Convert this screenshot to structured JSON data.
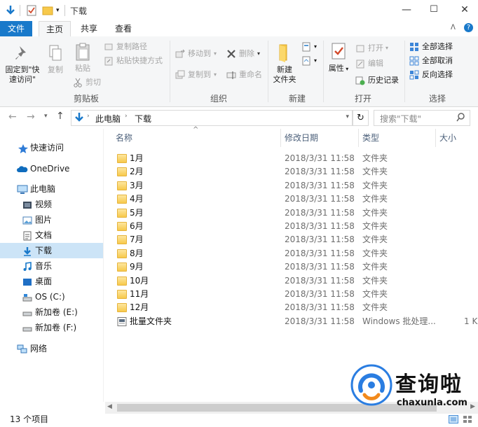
{
  "window": {
    "title": "下载",
    "minimize_glyph": "—",
    "maximize_glyph": "☐",
    "close_glyph": "✕"
  },
  "ribbon_tabs": [
    "文件",
    "主页",
    "共享",
    "查看"
  ],
  "ribbon": {
    "clipboard": {
      "pin_label_line1": "固定到\"快",
      "pin_label_line2": "速访问\"",
      "copy": "复制",
      "paste": "粘贴",
      "copy_path": "复制路径",
      "paste_shortcut": "粘贴快捷方式",
      "cut": "剪切",
      "group": "剪贴板"
    },
    "organize": {
      "move_to": "移动到",
      "copy_to": "复制到",
      "delete": "删除",
      "rename": "重命名",
      "group": "组织"
    },
    "new": {
      "new_folder_line1": "新建",
      "new_folder_line2": "文件夹",
      "group": "新建"
    },
    "open": {
      "properties": "属性",
      "open": "打开",
      "edit": "编辑",
      "history": "历史记录",
      "group": "打开"
    },
    "select": {
      "select_all": "全部选择",
      "select_none": "全部取消",
      "invert": "反向选择",
      "group": "选择"
    }
  },
  "address": {
    "crumb1": "此电脑",
    "crumb2": "下载",
    "search_placeholder": "搜索\"下载\""
  },
  "nav": {
    "quick_access": "快速访问",
    "onedrive": "OneDrive",
    "this_pc": "此电脑",
    "videos": "视频",
    "pictures": "图片",
    "documents": "文档",
    "downloads": "下载",
    "music": "音乐",
    "desktop": "桌面",
    "drive_c": "OS (C:)",
    "drive_e": "新加卷 (E:)",
    "drive_f": "新加卷 (F:)",
    "network": "网络"
  },
  "columns": {
    "name": "名称",
    "modified": "修改日期",
    "type": "类型",
    "size": "大小"
  },
  "files": [
    {
      "name": "1月",
      "modified": "2018/3/31 11:58",
      "type": "文件夹",
      "size": ""
    },
    {
      "name": "2月",
      "modified": "2018/3/31 11:58",
      "type": "文件夹",
      "size": ""
    },
    {
      "name": "3月",
      "modified": "2018/3/31 11:58",
      "type": "文件夹",
      "size": ""
    },
    {
      "name": "4月",
      "modified": "2018/3/31 11:58",
      "type": "文件夹",
      "size": ""
    },
    {
      "name": "5月",
      "modified": "2018/3/31 11:58",
      "type": "文件夹",
      "size": ""
    },
    {
      "name": "6月",
      "modified": "2018/3/31 11:58",
      "type": "文件夹",
      "size": ""
    },
    {
      "name": "7月",
      "modified": "2018/3/31 11:58",
      "type": "文件夹",
      "size": ""
    },
    {
      "name": "8月",
      "modified": "2018/3/31 11:58",
      "type": "文件夹",
      "size": ""
    },
    {
      "name": "9月",
      "modified": "2018/3/31 11:58",
      "type": "文件夹",
      "size": ""
    },
    {
      "name": "10月",
      "modified": "2018/3/31 11:58",
      "type": "文件夹",
      "size": ""
    },
    {
      "name": "11月",
      "modified": "2018/3/31 11:58",
      "type": "文件夹",
      "size": ""
    },
    {
      "name": "12月",
      "modified": "2018/3/31 11:58",
      "type": "文件夹",
      "size": ""
    },
    {
      "name": "批量文件夹",
      "modified": "2018/3/31 11:58",
      "type": "Windows 批处理...",
      "size": "1 K"
    }
  ],
  "status": {
    "count": "13 个项目"
  },
  "watermark": {
    "text": "查询啦",
    "url": "chaxunla.com"
  },
  "colors": {
    "accent": "#1979ca",
    "selection": "#cce4f7",
    "folder": "#f7c94b"
  }
}
